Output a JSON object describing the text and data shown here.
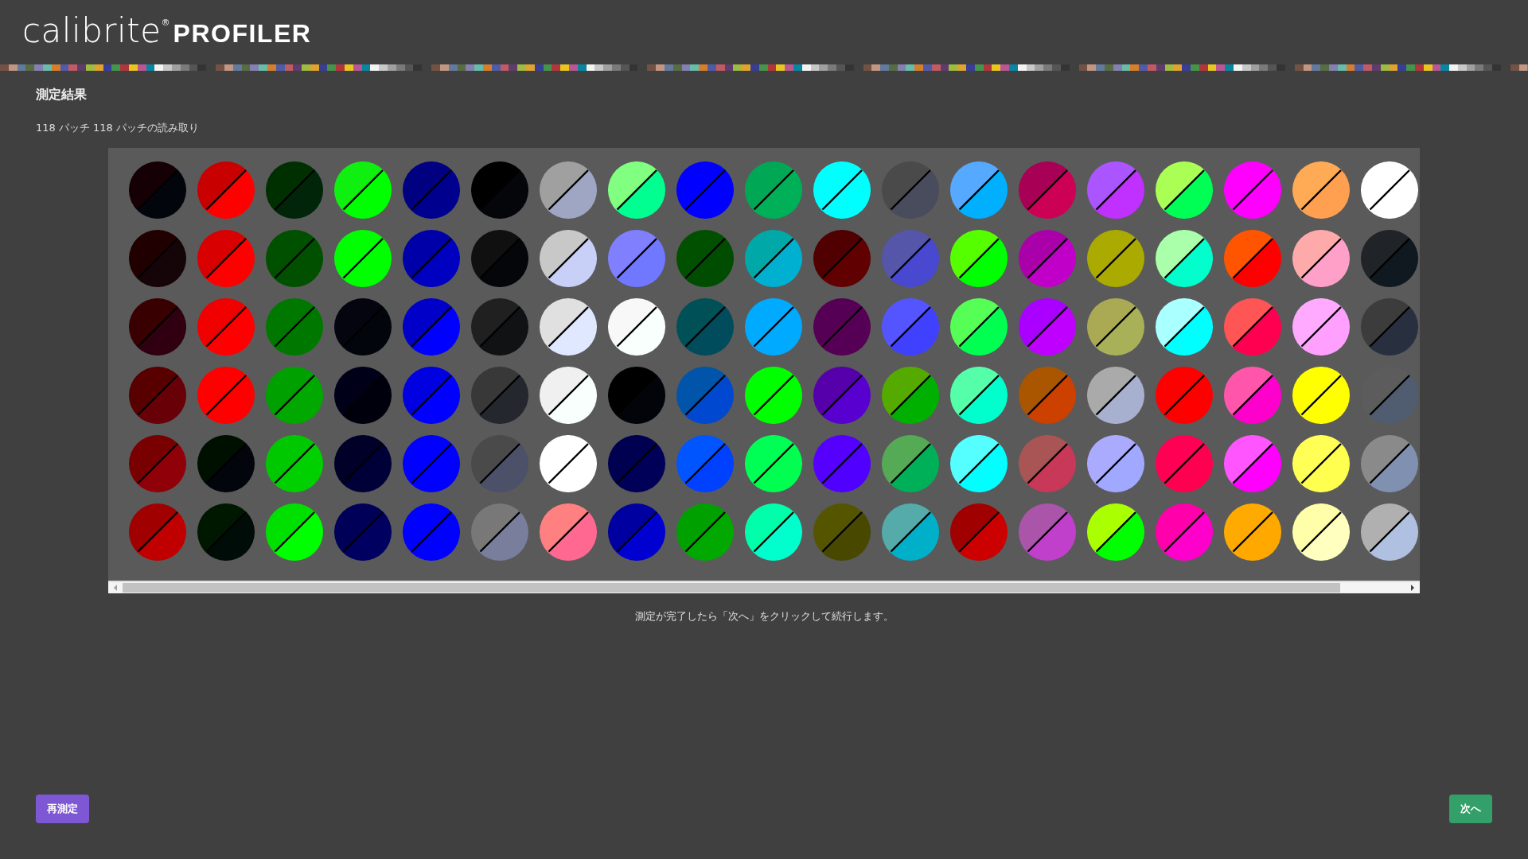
{
  "logo": {
    "brand": "calibrite",
    "registered": "®",
    "product": "PROFILER"
  },
  "heading": "測定結果",
  "summary": "118 パッチ 118 パッチの読み取り",
  "patches": [
    {
      "reference": {
        "color": "#150005"
      },
      "measured": {
        "color": "#02060c"
      }
    },
    {
      "reference": {
        "color": "#c80000"
      },
      "measured": {
        "color": "#ff0000"
      }
    },
    {
      "reference": {
        "color": "#003000"
      },
      "measured": {
        "color": "#002508"
      }
    },
    {
      "reference": {
        "color": "#10f010"
      },
      "measured": {
        "color": "#00ff00"
      }
    },
    {
      "reference": {
        "color": "#000080"
      },
      "measured": {
        "color": "#00008f"
      }
    },
    {
      "reference": {
        "color": "#000000"
      },
      "measured": {
        "color": "#04060a"
      }
    },
    {
      "reference": {
        "color": "#a0a0a0"
      },
      "measured": {
        "color": "#9ea6c4"
      }
    },
    {
      "reference": {
        "color": "#80ff80"
      },
      "measured": {
        "color": "#00ff90"
      }
    },
    {
      "reference": {
        "color": "#0000ff"
      },
      "measured": {
        "color": "#0000ff"
      }
    },
    {
      "reference": {
        "color": "#00a855"
      },
      "measured": {
        "color": "#00b058"
      }
    },
    {
      "reference": {
        "color": "#00ffff"
      },
      "measured": {
        "color": "#00ffff"
      }
    },
    {
      "reference": {
        "color": "#4a4a4a"
      },
      "measured": {
        "color": "#484c5c"
      }
    },
    {
      "reference": {
        "color": "#55aaff"
      },
      "measured": {
        "color": "#00b0ff"
      }
    },
    {
      "reference": {
        "color": "#a80055"
      },
      "measured": {
        "color": "#cc0055"
      }
    },
    {
      "reference": {
        "color": "#aa55ff"
      },
      "measured": {
        "color": "#c030ff"
      }
    },
    {
      "reference": {
        "color": "#aaff55"
      },
      "measured": {
        "color": "#00ff55"
      }
    },
    {
      "reference": {
        "color": "#ff00ff"
      },
      "measured": {
        "color": "#ff00ff"
      }
    },
    {
      "reference": {
        "color": "#ffaa55"
      },
      "measured": {
        "color": "#ffa050"
      }
    },
    {
      "reference": {
        "color": "#ffffff"
      },
      "measured": {
        "color": "#ffffff"
      }
    },
    {
      "reference": {
        "color": "#200000"
      },
      "measured": {
        "color": "#150508"
      }
    },
    {
      "reference": {
        "color": "#d80000"
      },
      "measured": {
        "color": "#ff0000"
      }
    },
    {
      "reference": {
        "color": "#005000"
      },
      "measured": {
        "color": "#005000"
      }
    },
    {
      "reference": {
        "color": "#00ff00"
      },
      "measured": {
        "color": "#00ff00"
      }
    },
    {
      "reference": {
        "color": "#0000a8"
      },
      "measured": {
        "color": "#0000c0"
      }
    },
    {
      "reference": {
        "color": "#101010"
      },
      "measured": {
        "color": "#04060a"
      }
    },
    {
      "reference": {
        "color": "#c8c8c8"
      },
      "measured": {
        "color": "#c8d0f8"
      }
    },
    {
      "reference": {
        "color": "#8080ff"
      },
      "measured": {
        "color": "#7078ff"
      }
    },
    {
      "reference": {
        "color": "#005000"
      },
      "measured": {
        "color": "#004c00"
      }
    },
    {
      "reference": {
        "color": "#00a8a8"
      },
      "measured": {
        "color": "#00b0d0"
      }
    },
    {
      "reference": {
        "color": "#500000"
      },
      "measured": {
        "color": "#600000"
      }
    },
    {
      "reference": {
        "color": "#5555aa"
      },
      "measured": {
        "color": "#4848d0"
      }
    },
    {
      "reference": {
        "color": "#55ff00"
      },
      "measured": {
        "color": "#00ff00"
      }
    },
    {
      "reference": {
        "color": "#aa00aa"
      },
      "measured": {
        "color": "#c000c8"
      }
    },
    {
      "reference": {
        "color": "#aaaa00"
      },
      "measured": {
        "color": "#aaaa00"
      }
    },
    {
      "reference": {
        "color": "#aaffaa"
      },
      "measured": {
        "color": "#00ffcc"
      }
    },
    {
      "reference": {
        "color": "#ff5500"
      },
      "measured": {
        "color": "#ff0000"
      }
    },
    {
      "reference": {
        "color": "#ffaaaa"
      },
      "measured": {
        "color": "#ffa0c8"
      }
    },
    {
      "reference": {
        "color": "#202428"
      },
      "measured": {
        "color": "#101820"
      }
    },
    {
      "reference": {
        "color": "#380000"
      },
      "measured": {
        "color": "#300010"
      }
    },
    {
      "reference": {
        "color": "#f00000"
      },
      "measured": {
        "color": "#ff0000"
      }
    },
    {
      "reference": {
        "color": "#007800"
      },
      "measured": {
        "color": "#007800"
      }
    },
    {
      "reference": {
        "color": "#050510"
      },
      "measured": {
        "color": "#02060c"
      }
    },
    {
      "reference": {
        "color": "#0000c8"
      },
      "measured": {
        "color": "#0000ff"
      }
    },
    {
      "reference": {
        "color": "#202020"
      },
      "measured": {
        "color": "#101214"
      }
    },
    {
      "reference": {
        "color": "#e0e0e0"
      },
      "measured": {
        "color": "#e0e8ff"
      }
    },
    {
      "reference": {
        "color": "#f8f8f8"
      },
      "measured": {
        "color": "#f8fffc"
      }
    },
    {
      "reference": {
        "color": "#005058"
      },
      "measured": {
        "color": "#004c5c"
      }
    },
    {
      "reference": {
        "color": "#00aaff"
      },
      "measured": {
        "color": "#00aaff"
      }
    },
    {
      "reference": {
        "color": "#550055"
      },
      "measured": {
        "color": "#550055"
      }
    },
    {
      "reference": {
        "color": "#5555ff"
      },
      "measured": {
        "color": "#4040ff"
      }
    },
    {
      "reference": {
        "color": "#55ff55"
      },
      "measured": {
        "color": "#00ff50"
      }
    },
    {
      "reference": {
        "color": "#aa00ff"
      },
      "measured": {
        "color": "#c000ff"
      }
    },
    {
      "reference": {
        "color": "#aaaa55"
      },
      "measured": {
        "color": "#a8b058"
      }
    },
    {
      "reference": {
        "color": "#aaffff"
      },
      "measured": {
        "color": "#00ffff"
      }
    },
    {
      "reference": {
        "color": "#ff5555"
      },
      "measured": {
        "color": "#ff0050"
      }
    },
    {
      "reference": {
        "color": "#ffaaff"
      },
      "measured": {
        "color": "#ffa0ff"
      }
    },
    {
      "reference": {
        "color": "#3c3c3c"
      },
      "measured": {
        "color": "#283040"
      }
    },
    {
      "reference": {
        "color": "#580000"
      },
      "measured": {
        "color": "#680008"
      }
    },
    {
      "reference": {
        "color": "#ff0000"
      },
      "measured": {
        "color": "#ff0000"
      }
    },
    {
      "reference": {
        "color": "#00a000"
      },
      "measured": {
        "color": "#00a800"
      }
    },
    {
      "reference": {
        "color": "#000018"
      },
      "measured": {
        "color": "#00000c"
      }
    },
    {
      "reference": {
        "color": "#0000e0"
      },
      "measured": {
        "color": "#0000ff"
      }
    },
    {
      "reference": {
        "color": "#383838"
      },
      "measured": {
        "color": "#24282e"
      }
    },
    {
      "reference": {
        "color": "#f0f0f0"
      },
      "measured": {
        "color": "#f8fffc"
      }
    },
    {
      "reference": {
        "color": "#000000"
      },
      "measured": {
        "color": "#02040a"
      }
    },
    {
      "reference": {
        "color": "#0055aa"
      },
      "measured": {
        "color": "#0048d0"
      }
    },
    {
      "reference": {
        "color": "#00ff00"
      },
      "measured": {
        "color": "#00ff00"
      }
    },
    {
      "reference": {
        "color": "#5500aa"
      },
      "measured": {
        "color": "#5800d0"
      }
    },
    {
      "reference": {
        "color": "#55aa00"
      },
      "measured": {
        "color": "#00b000"
      }
    },
    {
      "reference": {
        "color": "#55ffaa"
      },
      "measured": {
        "color": "#00ffcc"
      }
    },
    {
      "reference": {
        "color": "#aa5500"
      },
      "measured": {
        "color": "#cc4000"
      }
    },
    {
      "reference": {
        "color": "#aaaaaa"
      },
      "measured": {
        "color": "#a8b0d0"
      }
    },
    {
      "reference": {
        "color": "#ff0000"
      },
      "measured": {
        "color": "#ff0000"
      }
    },
    {
      "reference": {
        "color": "#ff55aa"
      },
      "measured": {
        "color": "#ff00cc"
      }
    },
    {
      "reference": {
        "color": "#ffff00"
      },
      "measured": {
        "color": "#ffff00"
      }
    },
    {
      "reference": {
        "color": "#5c5c5c"
      },
      "measured": {
        "color": "#505c70"
      }
    },
    {
      "reference": {
        "color": "#780000"
      },
      "measured": {
        "color": "#900008"
      }
    },
    {
      "reference": {
        "color": "#001000"
      },
      "measured": {
        "color": "#02060c"
      }
    },
    {
      "reference": {
        "color": "#00c800"
      },
      "measured": {
        "color": "#00d000"
      }
    },
    {
      "reference": {
        "color": "#000028"
      },
      "measured": {
        "color": "#000038"
      }
    },
    {
      "reference": {
        "color": "#0000ff"
      },
      "measured": {
        "color": "#0000ff"
      }
    },
    {
      "reference": {
        "color": "#4a4a4a"
      },
      "measured": {
        "color": "#4c5068"
      }
    },
    {
      "reference": {
        "color": "#ffffff"
      },
      "measured": {
        "color": "#ffffff"
      }
    },
    {
      "reference": {
        "color": "#000050"
      },
      "measured": {
        "color": "#000058"
      }
    },
    {
      "reference": {
        "color": "#0055ff"
      },
      "measured": {
        "color": "#0040ff"
      }
    },
    {
      "reference": {
        "color": "#00ff55"
      },
      "measured": {
        "color": "#00ff50"
      }
    },
    {
      "reference": {
        "color": "#5500ff"
      },
      "measured": {
        "color": "#5000ff"
      }
    },
    {
      "reference": {
        "color": "#55aa55"
      },
      "measured": {
        "color": "#00b058"
      }
    },
    {
      "reference": {
        "color": "#55ffff"
      },
      "measured": {
        "color": "#00ffff"
      }
    },
    {
      "reference": {
        "color": "#aa5555"
      },
      "measured": {
        "color": "#c83858"
      }
    },
    {
      "reference": {
        "color": "#aaaaff"
      },
      "measured": {
        "color": "#a0a8ff"
      }
    },
    {
      "reference": {
        "color": "#ff0055"
      },
      "measured": {
        "color": "#ff0050"
      }
    },
    {
      "reference": {
        "color": "#ff55ff"
      },
      "measured": {
        "color": "#ff00ff"
      }
    },
    {
      "reference": {
        "color": "#ffff55"
      },
      "measured": {
        "color": "#ffff50"
      }
    },
    {
      "reference": {
        "color": "#8a8a8a"
      },
      "measured": {
        "color": "#8090b0"
      }
    },
    {
      "reference": {
        "color": "#a00000"
      },
      "measured": {
        "color": "#c00000"
      }
    },
    {
      "reference": {
        "color": "#001800"
      },
      "measured": {
        "color": "#000c08"
      }
    },
    {
      "reference": {
        "color": "#00e000"
      },
      "measured": {
        "color": "#00ff00"
      }
    },
    {
      "reference": {
        "color": "#000058"
      },
      "measured": {
        "color": "#000060"
      }
    },
    {
      "reference": {
        "color": "#0000ff"
      },
      "measured": {
        "color": "#0000ff"
      }
    },
    {
      "reference": {
        "color": "#787878"
      },
      "measured": {
        "color": "#787e9c"
      }
    },
    {
      "reference": {
        "color": "#ff8080"
      },
      "measured": {
        "color": "#ff6890"
      }
    },
    {
      "reference": {
        "color": "#0000a0"
      },
      "measured": {
        "color": "#0000d0"
      }
    },
    {
      "reference": {
        "color": "#00a000"
      },
      "measured": {
        "color": "#00a800"
      }
    },
    {
      "reference": {
        "color": "#00ffaa"
      },
      "measured": {
        "color": "#00ffcc"
      }
    },
    {
      "reference": {
        "color": "#555500"
      },
      "measured": {
        "color": "#484800"
      }
    },
    {
      "reference": {
        "color": "#55aaaa"
      },
      "measured": {
        "color": "#00b0c8"
      }
    },
    {
      "reference": {
        "color": "#a00000"
      },
      "measured": {
        "color": "#cc0000"
      }
    },
    {
      "reference": {
        "color": "#aa55aa"
      },
      "measured": {
        "color": "#c040cc"
      }
    },
    {
      "reference": {
        "color": "#aaff00"
      },
      "measured": {
        "color": "#00ff00"
      }
    },
    {
      "reference": {
        "color": "#ff00aa"
      },
      "measured": {
        "color": "#ff00cc"
      }
    },
    {
      "reference": {
        "color": "#ffaa00"
      },
      "measured": {
        "color": "#ffa800"
      }
    },
    {
      "reference": {
        "color": "#ffffaa"
      },
      "measured": {
        "color": "#ffffc0"
      }
    },
    {
      "reference": {
        "color": "#b0b0b0"
      },
      "measured": {
        "color": "#b0c0e0"
      }
    }
  ],
  "instruction": "測定が完了したら「次へ」をクリックして続行します。",
  "buttons": {
    "remeasure": "再測定",
    "next": "次へ"
  }
}
